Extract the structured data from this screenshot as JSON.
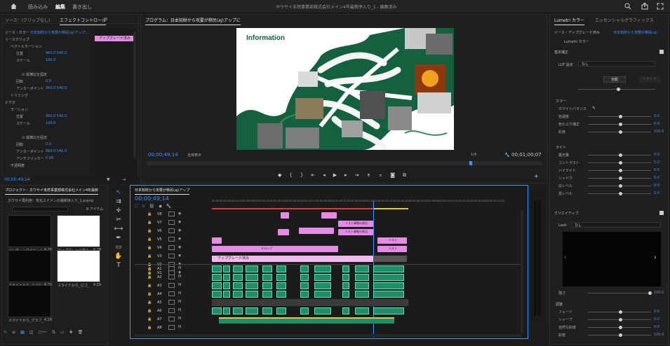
{
  "topbar": {
    "tab_import": "読み込み",
    "tab_edit": "編集",
    "tab_export": "書き出し",
    "title": "ホウサイ未然事業部株式会社メイン4年最新序入り_1 - 編集済み"
  },
  "effect_controls": {
    "tab_source": "ソース：(クリップなし)",
    "tab_effects": "エフェクトコントロール",
    "source_label": "ソース・カラー",
    "clip_name": "日本知財から攻要が移民(aj)アップ...",
    "master_name": "ソースクリップ",
    "pink_clip": "アップグレード済み",
    "rows": [
      {
        "label": "ベクトルモーション",
        "value": "",
        "indent": 1
      },
      {
        "label": "位置",
        "value": "960.0   540.0",
        "indent": 2
      },
      {
        "label": "スケール",
        "value": "100.0",
        "indent": 2
      },
      {
        "label": "",
        "value": "",
        "indent": 2
      },
      {
        "label": "縦横比を固定",
        "value": "",
        "indent": 3,
        "check": true
      },
      {
        "label": "回転",
        "value": "0.0",
        "indent": 2
      },
      {
        "label": "アンカーポイント",
        "value": "960.0   540.0",
        "indent": 2
      },
      {
        "label": "トリミング",
        "value": "",
        "indent": 1
      },
      {
        "label": "ビデオ",
        "value": "",
        "indent": 0
      },
      {
        "label": "モーション",
        "value": "",
        "indent": 1
      },
      {
        "label": "位置",
        "value": "960.0   540.0",
        "indent": 2
      },
      {
        "label": "スケール",
        "value": "100.0",
        "indent": 2
      },
      {
        "label": "",
        "value": "",
        "indent": 2
      },
      {
        "label": "縦横比を固定",
        "value": "",
        "indent": 3,
        "check": true
      },
      {
        "label": "回転",
        "value": "0.0",
        "indent": 2
      },
      {
        "label": "アンカーポイント",
        "value": "960.0   540.0",
        "indent": 2
      },
      {
        "label": "アンチフリッカー",
        "value": "0.00",
        "indent": 2
      },
      {
        "label": "不透明度",
        "value": "",
        "indent": 1
      }
    ],
    "timecode": "00;00;49;14"
  },
  "program": {
    "tab": "プログラム：日本知財から攻要が移民(aj)アップに",
    "slide_title": "Information",
    "timecode": "00;00;49;14",
    "fit": "全体表示",
    "quality": "1/4",
    "duration": "00;01;00;07"
  },
  "project": {
    "tab": "プロジェクト：ホウサイ未然事業部株式会社メイン4年最新",
    "bin": "ホウサイ再利用：攻化スイメンの最新序入り_1.prproj",
    "count": "9 アイテム",
    "items": [
      {
        "name": "ペンディングイベント",
        "dur": "4;28"
      },
      {
        "name": "アップグレード済み",
        "dur": "4;28"
      },
      {
        "name": "スライドから_スマホ_",
        "dur": "4;29"
      },
      {
        "name": "スライドから_ロゴ_",
        "dur": "4;29"
      },
      {
        "name": "スライドから_グラフ_",
        "dur": "4;29"
      }
    ]
  },
  "timeline": {
    "tab": "日本知財から攻要が移民(aj)アップ",
    "timecode": "00;00;49;14",
    "ruler": [
      "00;00;00;00",
      "00;00;04;00",
      "00;00;08;00",
      "00;00;12;00",
      "00;00;16;00",
      "00;00;20;00",
      "00;00;24;00",
      "00;00;28;00",
      "00;00;32;00",
      "00;00;36;00",
      "00;00;40;00",
      "00;00;44;00",
      "00;00;48;00",
      "00;00;52;00",
      "00;00;56;00",
      "00;01;00;02",
      "00;01;04;02",
      "00;01;08;02",
      "00;01;12;02"
    ],
    "vtracks": [
      "V8",
      "V7",
      "V6",
      "V5",
      "V4",
      "V3",
      "V2",
      "V1"
    ],
    "atracks": [
      "A1",
      "A2",
      "A3",
      "A4",
      "A5",
      "A6",
      "A7",
      "A8"
    ],
    "v1_clip": "アップグレード済み",
    "clips_text": [
      "ミスト事態の周辺",
      "ミスト事態の周辺",
      "ミスト",
      "ミスト",
      "テロップ"
    ]
  },
  "lumetri": {
    "tab_color": "Lumetri カラー",
    "tab_graphics": "エッセンシャルグラフィックス",
    "source": "ソース・アップグレード済み",
    "target": "日本知財から攻要が移民(aj)",
    "header": "Lumetri カラー",
    "basic": "基本補正",
    "lut_label": "LUT 設定",
    "lut_value": "なし",
    "auto": "自動",
    "reset": "リセット",
    "sections": [
      "カラー",
      "ライト"
    ],
    "color_rows": [
      {
        "label": "ホワイトバランス",
        "value": ""
      },
      {
        "label": "色温度",
        "value": "0.0"
      },
      {
        "label": "色かぶり補正",
        "value": "0.0"
      },
      {
        "label": "彩度",
        "value": "100.0"
      }
    ],
    "light_rows": [
      {
        "label": "露光量",
        "value": "0.0"
      },
      {
        "label": "コントラスト",
        "value": "0.0"
      },
      {
        "label": "ハイライト",
        "value": "0.0"
      },
      {
        "label": "シャドウ",
        "value": "0.0"
      },
      {
        "label": "白レベル",
        "value": "0.0"
      },
      {
        "label": "黒レベル",
        "value": "0.0"
      }
    ],
    "creative": "クリエイティブ",
    "look_label": "Look",
    "look_value": "なし",
    "intensity": "強さ",
    "intensity_value": "100.0",
    "adjust": "調整",
    "adjust_rows": [
      {
        "label": "フェード",
        "value": "0.0"
      },
      {
        "label": "シャープ",
        "value": "0.0"
      },
      {
        "label": "自然な彩度",
        "value": "0.0"
      },
      {
        "label": "彩度",
        "value": "100.0"
      }
    ]
  }
}
